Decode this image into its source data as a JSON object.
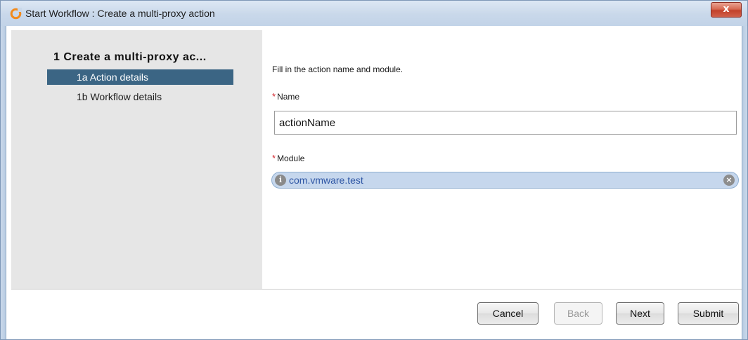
{
  "window": {
    "title": "Start Workflow : Create a multi-proxy action",
    "close_label": "x"
  },
  "sidebar": {
    "step_title": "1  Create a multi-proxy  ac...",
    "items": [
      {
        "label": "1a  Action details",
        "selected": true
      },
      {
        "label": "1b  Workflow details",
        "selected": false
      }
    ]
  },
  "form": {
    "intro": "Fill in the action name and module.",
    "required_mark": "*",
    "name_label": "Name",
    "name_value": "actionName",
    "module_label": "Module",
    "module_value": "com.vmware.test",
    "module_info_glyph": "i",
    "module_clear_glyph": "×"
  },
  "buttons": {
    "cancel": "Cancel",
    "back": "Back",
    "next": "Next",
    "submit": "Submit"
  },
  "colors": {
    "selected_step": "#3b6584",
    "chip_background": "#c6d7ed",
    "required": "#d2262e"
  }
}
